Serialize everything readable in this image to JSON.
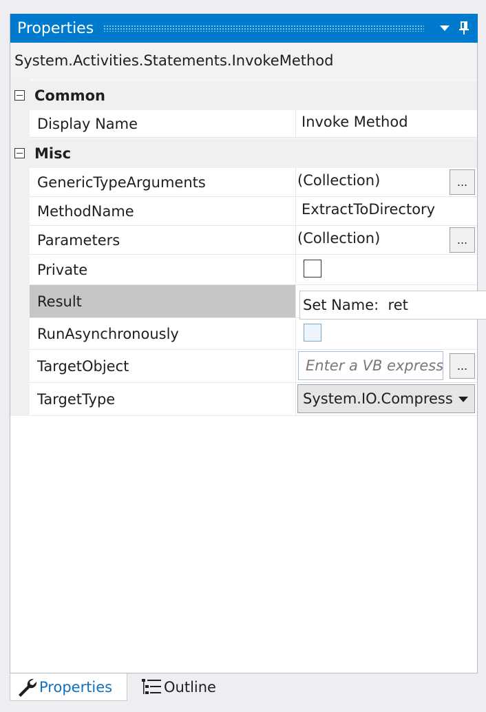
{
  "window": {
    "title": "Properties",
    "dropdown_icon": "chevron-down-icon",
    "pin_icon": "pin-icon",
    "title_bg": "#007acc"
  },
  "type_name": "System.Activities.Statements.InvokeMethod",
  "categories": [
    {
      "label": "Common"
    },
    {
      "label": "Misc"
    }
  ],
  "properties": {
    "display_name": {
      "name": "Display Name",
      "value": "Invoke Method"
    },
    "generic_type_arguments": {
      "name": "GenericTypeArguments",
      "value": "(Collection)",
      "button": "..."
    },
    "method_name": {
      "name": "MethodName",
      "value": "ExtractToDirectory"
    },
    "parameters": {
      "name": "Parameters",
      "value": "(Collection)",
      "button": "..."
    },
    "private": {
      "name": "Private",
      "checked": false
    },
    "result": {
      "name": "Result",
      "value": "Set Name:  ret"
    },
    "run_asynchronously": {
      "name": "RunAsynchronously",
      "checked": false
    },
    "target_object": {
      "name": "TargetObject",
      "placeholder": "Enter a VB express",
      "button": "..."
    },
    "target_type": {
      "name": "TargetType",
      "value": "System.IO.Compress"
    }
  },
  "tabs": [
    {
      "label": "Properties",
      "icon": "wrench-icon",
      "active": true
    },
    {
      "label": "Outline",
      "icon": "outline-tree-icon",
      "active": false
    }
  ],
  "colors": {
    "accent": "#007acc",
    "selected_row": "#c6c6c6",
    "active_tab_text": "#0e70c0"
  }
}
